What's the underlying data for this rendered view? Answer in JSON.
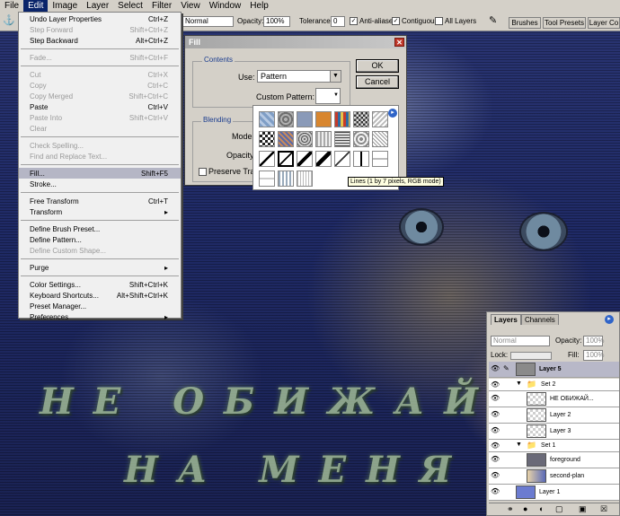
{
  "menubar": [
    "File",
    "Edit",
    "Image",
    "Layer",
    "Select",
    "Filter",
    "View",
    "Window",
    "Help"
  ],
  "options": {
    "mode_value": "Normal",
    "opacity_label": "Opacity:",
    "opacity_value": "100%",
    "tolerance_label": "Tolerance:",
    "tolerance_value": "0",
    "anti_aliased": "Anti-aliased",
    "contiguous": "Contiguous",
    "all_layers": "All Layers",
    "tabs": [
      "Brushes",
      "Tool Presets",
      "Layer Co"
    ]
  },
  "edit_menu": [
    {
      "label": "Undo Layer Properties",
      "shortcut": "Ctrl+Z"
    },
    {
      "label": "Step Forward",
      "shortcut": "Shift+Ctrl+Z",
      "disabled": true
    },
    {
      "label": "Step Backward",
      "shortcut": "Alt+Ctrl+Z"
    },
    {
      "sep": true
    },
    {
      "label": "Fade...",
      "shortcut": "Shift+Ctrl+F",
      "disabled": true
    },
    {
      "sep": true
    },
    {
      "label": "Cut",
      "shortcut": "Ctrl+X",
      "disabled": true
    },
    {
      "label": "Copy",
      "shortcut": "Ctrl+C",
      "disabled": true
    },
    {
      "label": "Copy Merged",
      "shortcut": "Shift+Ctrl+C",
      "disabled": true
    },
    {
      "label": "Paste",
      "shortcut": "Ctrl+V"
    },
    {
      "label": "Paste Into",
      "shortcut": "Shift+Ctrl+V",
      "disabled": true
    },
    {
      "label": "Clear",
      "shortcut": "",
      "disabled": true
    },
    {
      "sep": true
    },
    {
      "label": "Check Spelling...",
      "shortcut": "",
      "disabled": true
    },
    {
      "label": "Find and Replace Text...",
      "shortcut": "",
      "disabled": true
    },
    {
      "sep": true
    },
    {
      "label": "Fill...",
      "shortcut": "Shift+F5",
      "highlight": true
    },
    {
      "label": "Stroke...",
      "shortcut": ""
    },
    {
      "sep": true
    },
    {
      "label": "Free Transform",
      "shortcut": "Ctrl+T"
    },
    {
      "label": "Transform",
      "shortcut": "▸"
    },
    {
      "sep": true
    },
    {
      "label": "Define Brush Preset...",
      "shortcut": ""
    },
    {
      "label": "Define Pattern...",
      "shortcut": ""
    },
    {
      "label": "Define Custom Shape...",
      "shortcut": "",
      "disabled": true
    },
    {
      "sep": true
    },
    {
      "label": "Purge",
      "shortcut": "▸"
    },
    {
      "sep": true
    },
    {
      "label": "Color Settings...",
      "shortcut": "Shift+Ctrl+K"
    },
    {
      "label": "Keyboard Shortcuts...",
      "shortcut": "Alt+Shift+Ctrl+K"
    },
    {
      "label": "Preset Manager...",
      "shortcut": ""
    },
    {
      "label": "Preferences",
      "shortcut": "▸"
    }
  ],
  "fill_dialog": {
    "title": "Fill",
    "contents_label": "Contents",
    "use_label": "Use:",
    "use_value": "Pattern",
    "custom_pattern_label": "Custom Pattern:",
    "blending_label": "Blending",
    "mode_label": "Mode",
    "opacity_label": "Opacity",
    "preserve_label": "Preserve Tra",
    "ok": "OK",
    "cancel": "Cancel"
  },
  "pattern_tooltip": "Lines (1 by 7 pixels, RGB mode)",
  "canvas_text": {
    "line1": "НЕ ОБИЖАЙСЯ",
    "line2": "НА МЕНЯ"
  },
  "layers_panel": {
    "tabs": [
      "Layers",
      "Channels"
    ],
    "blend_mode": "Normal",
    "opacity_label": "Opacity:",
    "opacity_value": "100%",
    "lock_label": "Lock:",
    "fill_label": "Fill:",
    "fill_value": "100%",
    "rows": [
      "Layer 5",
      "Set 2",
      "НЕ ОБИЖАЙ...",
      "Layer 2",
      "Layer 3",
      "Set 1",
      "foreground",
      "second-plan",
      "Layer 1"
    ]
  },
  "colors": {
    "menu_highlight": "#0a246a",
    "selected_item": "#b5b6c5",
    "dialog_bg": "#d4d0c8",
    "group_label": "#1b3d8f",
    "text_overlay": "#a9c49a"
  }
}
